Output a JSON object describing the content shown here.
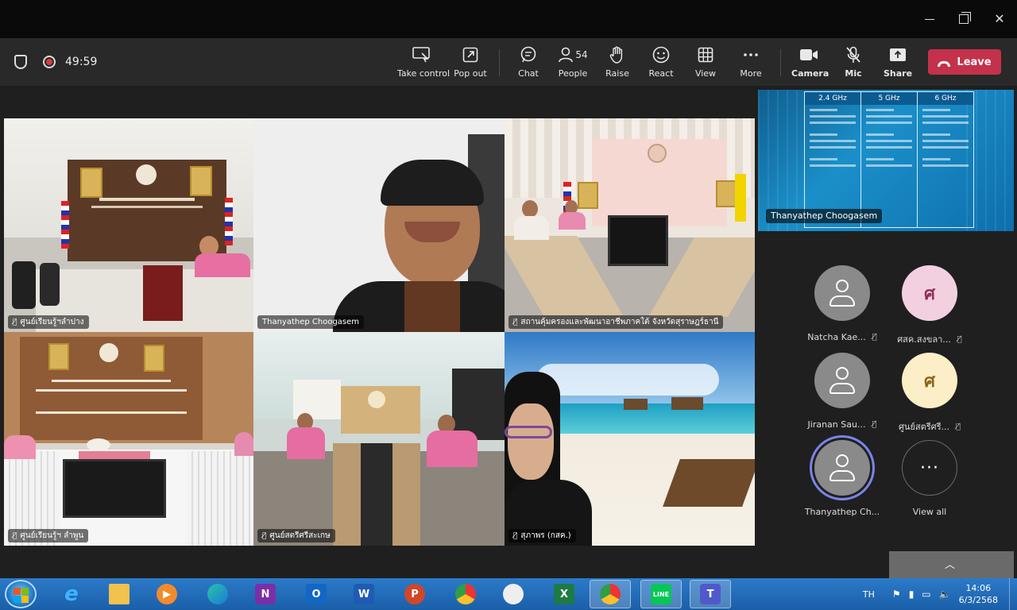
{
  "window": {
    "controls": {
      "minimize": "",
      "maximize": "",
      "close": "✕"
    }
  },
  "meeting": {
    "timer": "49:59",
    "toolbar": {
      "take_control": "Take control",
      "pop_out": "Pop out",
      "chat": "Chat",
      "people": "People",
      "people_count": "54",
      "raise": "Raise",
      "react": "React",
      "view": "View",
      "more": "More",
      "camera": "Camera",
      "mic": "Mic",
      "share": "Share",
      "leave": "Leave"
    }
  },
  "gallery": {
    "tiles": [
      {
        "name": "ศูนย์เรียนรู้ฯลำปาง",
        "muted": true
      },
      {
        "name": "Thanyathep Choogasem",
        "muted": false
      },
      {
        "name": "สถานคุ้มครองและพัฒนาอาชีพภาคใต้ จังหวัดสุราษฎร์ธานี",
        "muted": true
      },
      {
        "name": "ศูนย์เรียนรู้ฯ ลำพูน",
        "muted": true
      },
      {
        "name": "ศูนย์สตรีศรีสะเกษ",
        "muted": true
      },
      {
        "name": "สุภาพร (กสค.)",
        "muted": true
      }
    ]
  },
  "share_preview": {
    "presenter": "Thanyathep Choogasem",
    "columns": [
      "2.4 GHz",
      "5 GHz",
      "6 GHz"
    ]
  },
  "participants": [
    {
      "name": "Natcha Kae...",
      "initial": "",
      "style": "grey",
      "muted": true
    },
    {
      "name": "ศสค.สงขลา...",
      "initial": "ศ",
      "style": "pink",
      "muted": true
    },
    {
      "name": "Jiranan Sau...",
      "initial": "",
      "style": "grey",
      "muted": true
    },
    {
      "name": "ศูนย์สตรีศรี...",
      "initial": "ศ",
      "style": "cream",
      "muted": true
    },
    {
      "name": "Thanyathep Ch...",
      "initial": "",
      "style": "grey",
      "muted": false
    }
  ],
  "view_all": {
    "label": "View all",
    "glyph": "···"
  },
  "taskbar": {
    "apps": [
      "N",
      "O",
      "W",
      "P",
      "X",
      "LINE",
      "T"
    ],
    "tray": {
      "language": "TH",
      "time": "14:06",
      "date": "6/3/2568"
    }
  },
  "colors": {
    "leave": "#c4314b",
    "speaking_ring": "#7b83eb",
    "toolbar_bg": "#292929"
  }
}
